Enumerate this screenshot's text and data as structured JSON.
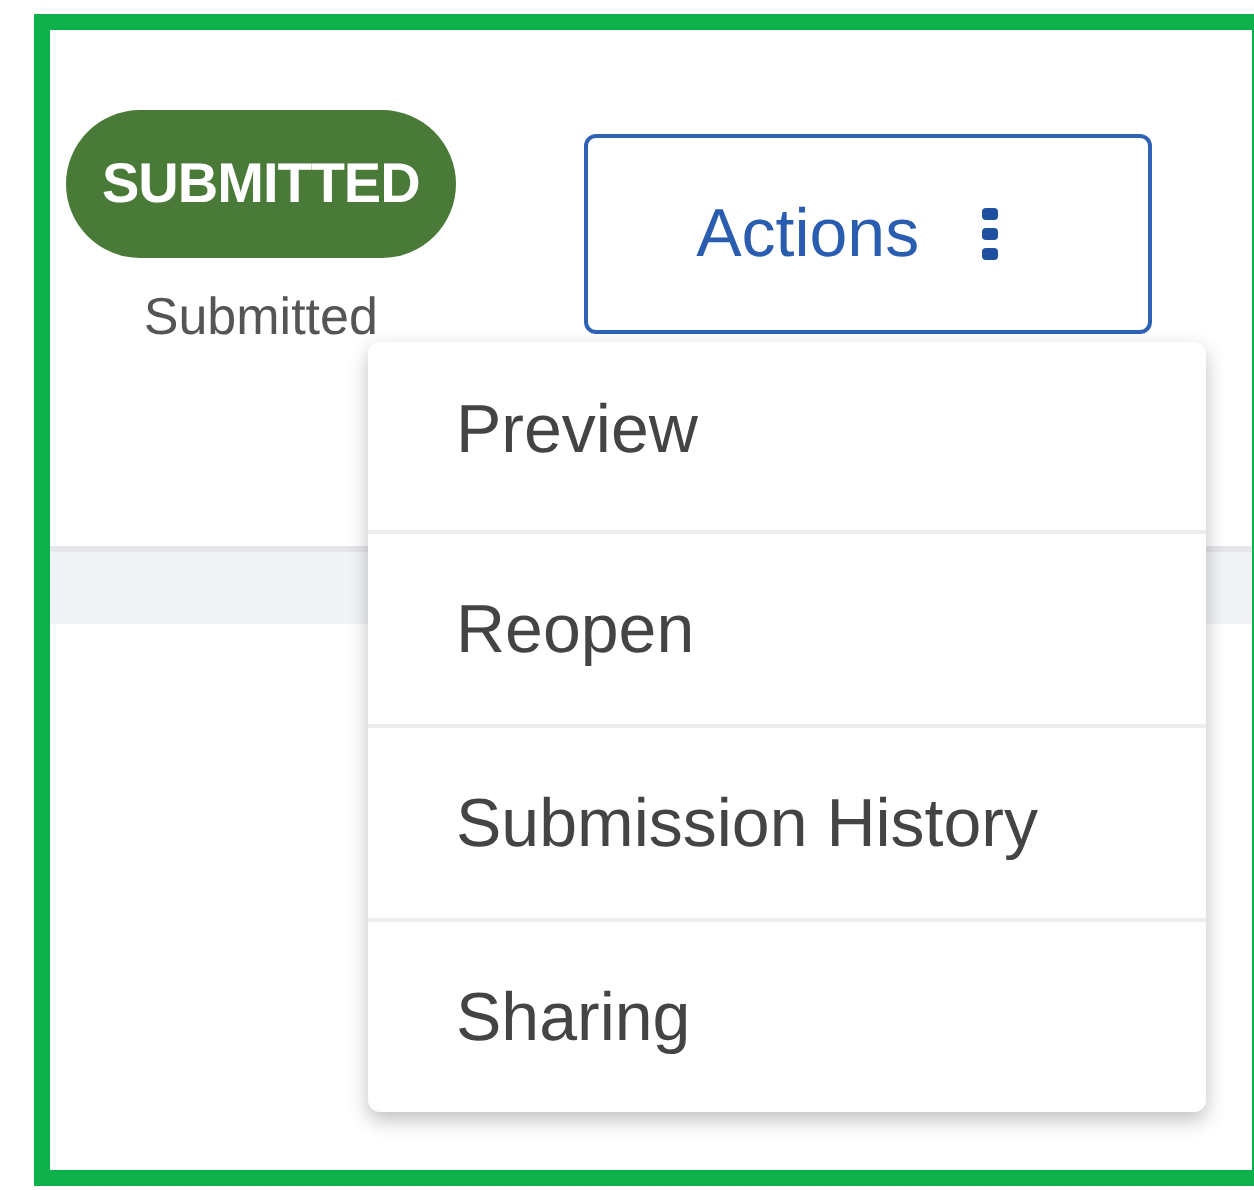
{
  "status": {
    "badge": "SUBMITTED",
    "caption": "Submitted"
  },
  "actions_button": {
    "label": "Actions",
    "expanded": true
  },
  "menu": {
    "items": [
      {
        "label": "Preview"
      },
      {
        "label": "Reopen"
      },
      {
        "label": "Submission History"
      },
      {
        "label": "Sharing"
      }
    ]
  }
}
